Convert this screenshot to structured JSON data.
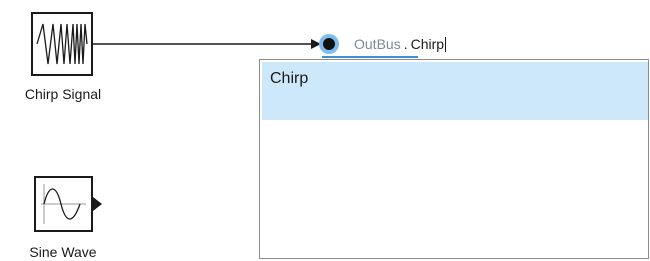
{
  "blocks": {
    "chirp": {
      "label": "Chirp Signal",
      "icon": "chirp-waveform-icon"
    },
    "sine": {
      "label": "Sine Wave",
      "icon": "sine-waveform-icon"
    }
  },
  "bus_editor": {
    "bus_name": "OutBus",
    "separator": ".",
    "element_text": "Chirp"
  },
  "suggestions": [
    {
      "label": "Chirp",
      "selected": true
    }
  ],
  "colors": {
    "highlight": "#cde8fb",
    "port_accent": "#3d8fd1",
    "bus_name_text": "#7a8a96"
  }
}
